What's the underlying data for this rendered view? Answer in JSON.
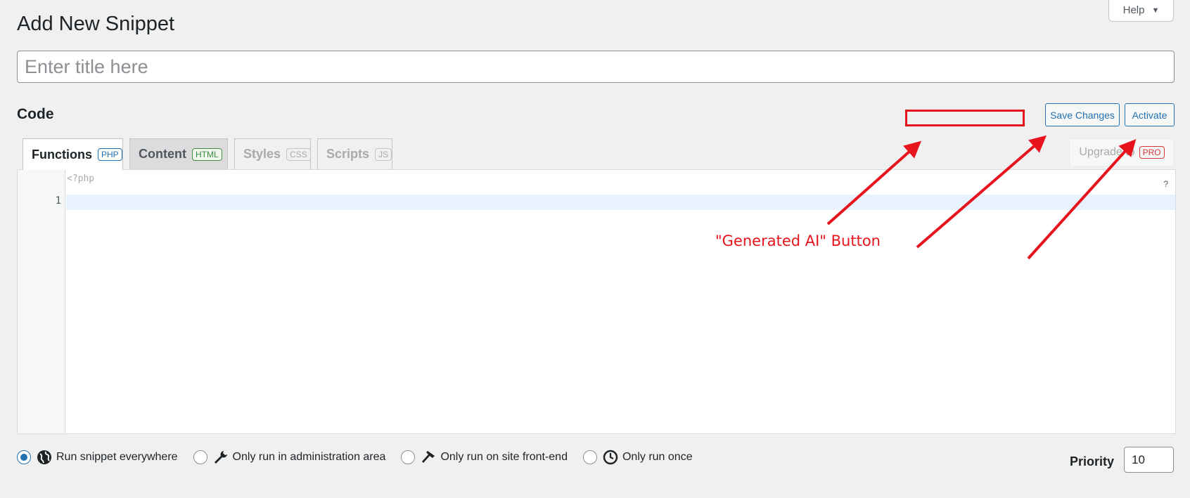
{
  "help": {
    "label": "Help",
    "caret": "▼"
  },
  "page": {
    "title": "Add New Snippet"
  },
  "title_input": {
    "placeholder": "Enter title here",
    "value": ""
  },
  "code_section": {
    "label": "Code"
  },
  "toolbar": {
    "save_label": "Save Changes",
    "activate_label": "Activate",
    "upgrade_label": "Upgrade to",
    "pro_badge": "PRO"
  },
  "tabs": [
    {
      "label": "Functions",
      "badge": "PHP",
      "state": "active"
    },
    {
      "label": "Content",
      "badge": "HTML",
      "state": "hover"
    },
    {
      "label": "Styles",
      "badge": "CSS",
      "state": "disabled"
    },
    {
      "label": "Scripts",
      "badge": "JS",
      "state": "disabled"
    }
  ],
  "editor": {
    "php_open": "<?php",
    "line_number": "1",
    "help_mark": "?"
  },
  "annotation": {
    "label": "\"Generated AI\" Button",
    "color": "#e8141d"
  },
  "scope_options": [
    {
      "label": "Run snippet everywhere",
      "icon": "globe-icon",
      "checked": true
    },
    {
      "label": "Only run in administration area",
      "icon": "wrench-icon",
      "checked": false
    },
    {
      "label": "Only run on site front-end",
      "icon": "hammer-icon",
      "checked": false
    },
    {
      "label": "Only run once",
      "icon": "clock-icon",
      "checked": false
    }
  ],
  "priority": {
    "label": "Priority",
    "value": "10"
  },
  "colors": {
    "accent": "#2271b1",
    "background": "#f0f0f1",
    "pro": "#d63638",
    "html_badge": "#3f8e3e"
  }
}
